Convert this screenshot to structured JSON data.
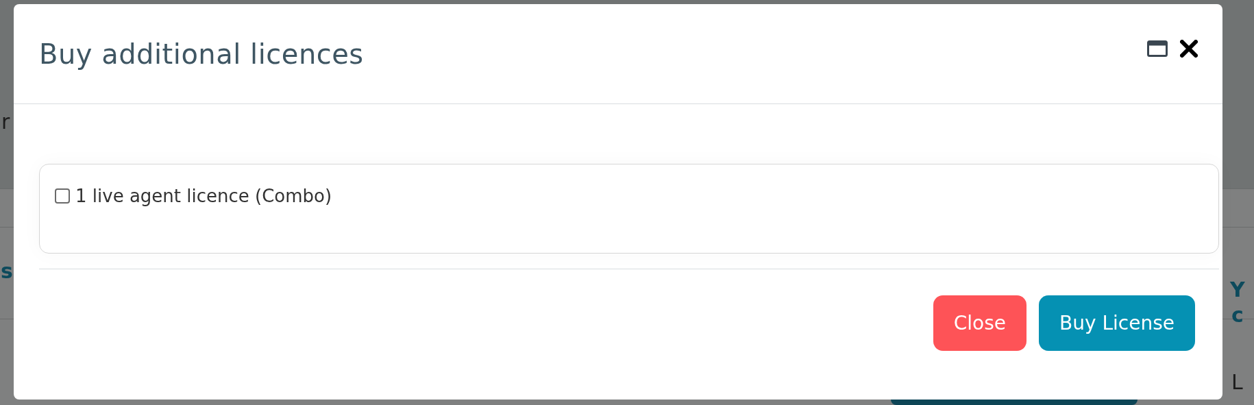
{
  "background": {
    "texts": [
      {
        "kind": "plain",
        "text": "r"
      },
      {
        "kind": "link",
        "text": "s"
      },
      {
        "kind": "link",
        "text": "Y"
      },
      {
        "kind": "link",
        "text": "c"
      },
      {
        "kind": "plain",
        "text": "L"
      }
    ]
  },
  "dialog": {
    "title": "Buy additional licences",
    "options": [
      {
        "label": "1 live agent licence (Combo)",
        "checked": false
      }
    ],
    "buttons": [
      {
        "kind": "danger",
        "label": "Close"
      },
      {
        "kind": "primary",
        "label": "Buy License"
      }
    ]
  }
}
